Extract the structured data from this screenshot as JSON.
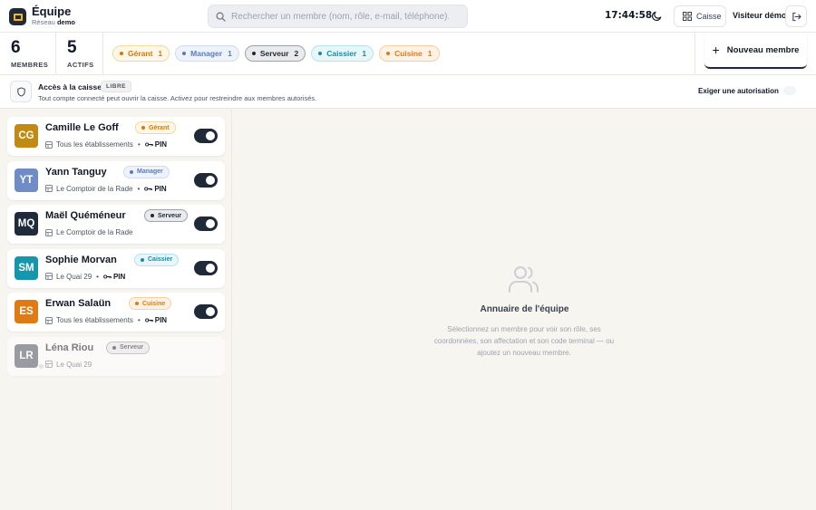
{
  "app": {
    "title": "Équipe",
    "network_prefix": "Réseau",
    "network_name": "demo"
  },
  "search": {
    "placeholder": "Rechercher un membre (nom, rôle, e-mail, téléphone)..."
  },
  "header": {
    "clock": "17:44:58",
    "caisse_label": "Caisse",
    "visitor": "Visiteur démo"
  },
  "stats": {
    "members_count": "6",
    "members_label": "MEMBRES",
    "active_count": "5",
    "active_label": "ACTIFS"
  },
  "roles": [
    {
      "label": "Gérant",
      "count": "1",
      "color": "#d97706",
      "bg": "#fff7e6",
      "border": "#f3d8a6"
    },
    {
      "label": "Manager",
      "count": "1",
      "color": "#5b7bb8",
      "bg": "#eef2fa",
      "border": "#d2dcef"
    },
    {
      "label": "Serveur",
      "count": "2",
      "color": "#1f2937",
      "bg": "#e9eaec",
      "border": "#9ca3af"
    },
    {
      "label": "Caissier",
      "count": "1",
      "color": "#0e8fa8",
      "bg": "#e8f6f9",
      "border": "#b8e2ea"
    },
    {
      "label": "Cuisine",
      "count": "1",
      "color": "#e07b14",
      "bg": "#fff2e4",
      "border": "#f5cfa4"
    }
  ],
  "new_member_label": "Nouveau membre",
  "access": {
    "title": "Accès à la caisse",
    "badge": "LIBRE",
    "description": "Tout compte connecté peut ouvrir la caisse. Activez pour restreindre aux membres autorisés.",
    "toggle_label": "Exiger une autorisation"
  },
  "members": [
    {
      "initials": "CG",
      "name": "Camille Le Goff",
      "role": "Gérant",
      "location": "Tous les établissements",
      "pin": "PIN",
      "avatar_color": "#c28a12",
      "active": true
    },
    {
      "initials": "YT",
      "name": "Yann Tanguy",
      "role": "Manager",
      "location": "Le Comptoir de la Rade",
      "pin": "PIN",
      "avatar_color": "#6f8cc7",
      "active": true
    },
    {
      "initials": "MQ",
      "name": "Maël Quéméneur",
      "role": "Serveur",
      "location": "Le Comptoir de la Rade",
      "pin": "",
      "avatar_color": "#1f2a3a",
      "active": true
    },
    {
      "initials": "SM",
      "name": "Sophie Morvan",
      "role": "Caissier",
      "location": "Le Quai 29",
      "pin": "PIN",
      "avatar_color": "#1596ad",
      "active": true
    },
    {
      "initials": "ES",
      "name": "Erwan Salaün",
      "role": "Cuisine",
      "location": "Tous les établissements",
      "pin": "PIN",
      "avatar_color": "#e07b14",
      "active": true
    },
    {
      "initials": "LR",
      "name": "Léna Riou",
      "role": "Serveur",
      "location": "Le Quai 29",
      "pin": "",
      "avatar_color": "#4b5563",
      "active": false
    }
  ],
  "empty_state": {
    "title": "Annuaire de l'équipe",
    "description": "Sélectionnez un membre pour voir son rôle, ses coordonnées, son affectation et son code terminal — ou ajoutez un nouveau membre."
  }
}
